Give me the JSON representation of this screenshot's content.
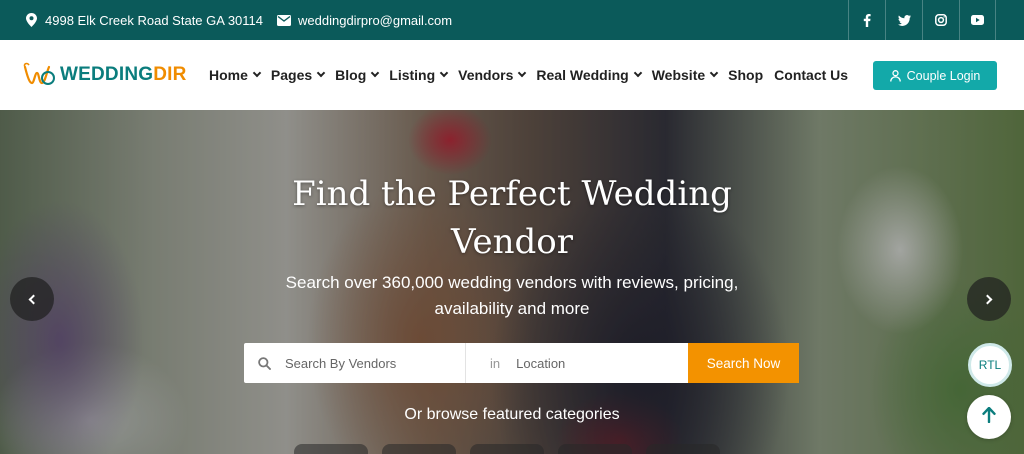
{
  "topbar": {
    "address": "4998 Elk Creek Road State GA 30114",
    "email": "weddingdirpro@gmail.com",
    "social": [
      {
        "icon": "facebook-icon",
        "glyph": "f"
      },
      {
        "icon": "twitter-icon",
        "glyph": "t"
      },
      {
        "icon": "instagram-icon",
        "glyph": "ig"
      },
      {
        "icon": "youtube-icon",
        "glyph": "yt"
      }
    ]
  },
  "logo": {
    "part1": "WEDDING",
    "part2": "DIR"
  },
  "nav": {
    "items": [
      {
        "label": "Home",
        "dropdown": true
      },
      {
        "label": "Pages",
        "dropdown": true
      },
      {
        "label": "Blog",
        "dropdown": true
      },
      {
        "label": "Listing",
        "dropdown": true
      },
      {
        "label": "Vendors",
        "dropdown": true
      },
      {
        "label": "Real Wedding",
        "dropdown": true
      },
      {
        "label": "Website",
        "dropdown": true
      },
      {
        "label": "Shop",
        "dropdown": false
      },
      {
        "label": "Contact Us",
        "dropdown": false
      }
    ],
    "login_label": "Couple Login"
  },
  "hero": {
    "title": "Find the Perfect Wedding Vendor",
    "subtitle": "Search over 360,000 wedding vendors with reviews, pricing, availability and more",
    "search": {
      "vendor_placeholder": "Search By Vendors",
      "in_label": "in",
      "location_placeholder": "Location",
      "button_label": "Search Now"
    },
    "browse_text": "Or browse featured categories",
    "rtl_label": "RTL"
  },
  "colors": {
    "topbar": "#0b5a5a",
    "primary": "#13a9a9",
    "accent": "#f39200"
  }
}
